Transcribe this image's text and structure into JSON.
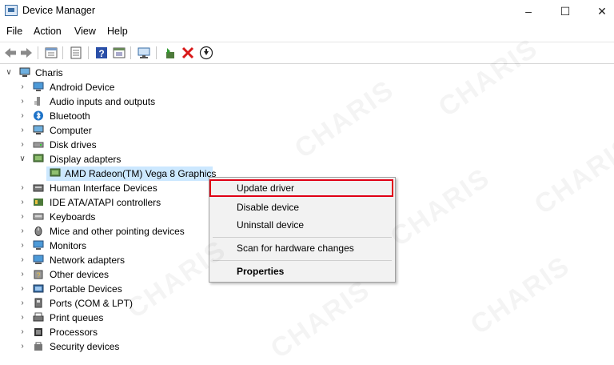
{
  "window": {
    "title": "Device Manager"
  },
  "menu": [
    "File",
    "Action",
    "View",
    "Help"
  ],
  "tree": {
    "root": "Charis",
    "categories": [
      {
        "label": "Android Device",
        "icon": "monitor-icon"
      },
      {
        "label": "Audio inputs and outputs",
        "icon": "speaker-icon"
      },
      {
        "label": "Bluetooth",
        "icon": "bluetooth-icon"
      },
      {
        "label": "Computer",
        "icon": "computer-icon"
      },
      {
        "label": "Disk drives",
        "icon": "disk-icon"
      },
      {
        "label": "Display adapters",
        "icon": "display-adapter-icon",
        "expanded": true
      },
      {
        "label": "Human Interface Devices",
        "icon": "hid-icon"
      },
      {
        "label": "IDE ATA/ATAPI controllers",
        "icon": "ide-icon"
      },
      {
        "label": "Keyboards",
        "icon": "keyboard-icon"
      },
      {
        "label": "Mice and other pointing devices",
        "icon": "mouse-icon"
      },
      {
        "label": "Monitors",
        "icon": "monitor-icon"
      },
      {
        "label": "Network adapters",
        "icon": "network-icon"
      },
      {
        "label": "Other devices",
        "icon": "other-device-icon"
      },
      {
        "label": "Portable Devices",
        "icon": "portable-icon"
      },
      {
        "label": "Ports (COM & LPT)",
        "icon": "port-icon"
      },
      {
        "label": "Print queues",
        "icon": "printer-icon"
      },
      {
        "label": "Processors",
        "icon": "processor-icon"
      },
      {
        "label": "Security devices",
        "icon": "security-icon"
      }
    ],
    "child": "AMD Radeon(TM) Vega 8 Graphics"
  },
  "context_menu": {
    "items": [
      "Update driver",
      "Disable device",
      "Uninstall device",
      "Scan for hardware changes",
      "Properties"
    ],
    "highlight_color": "#e00015"
  },
  "watermark": "CHARIS"
}
